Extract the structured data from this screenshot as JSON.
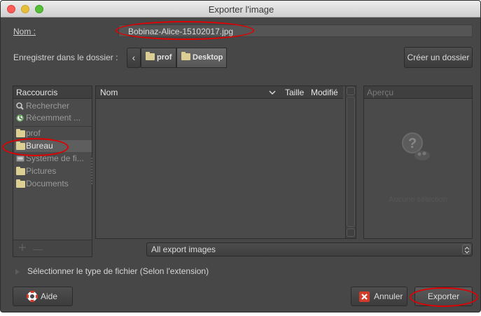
{
  "window": {
    "title": "Exporter l'image"
  },
  "name_row": {
    "label": "Nom :",
    "value": "Bobinaz-Alice-15102017.jpg"
  },
  "folder_row": {
    "label": "Enregistrer dans le dossier :",
    "back_glyph": "‹",
    "path": [
      "prof",
      "Desktop"
    ],
    "create_folder": "Créer un dossier"
  },
  "places": {
    "header": "Raccourcis",
    "items": [
      {
        "label": "Rechercher",
        "icon": "search-icon"
      },
      {
        "label": "Récemment ...",
        "icon": "recent-icon"
      },
      {
        "label": "prof",
        "icon": "folder-icon"
      },
      {
        "label": "Bureau",
        "icon": "folder-icon",
        "selected": true
      },
      {
        "label": "Système de fi...",
        "icon": "drive-icon"
      },
      {
        "label": "Pictures",
        "icon": "folder-icon"
      },
      {
        "label": "Documents",
        "icon": "folder-icon"
      }
    ],
    "add": "+",
    "remove": "—"
  },
  "files": {
    "col_name": "Nom",
    "col_size": "Taille",
    "col_modified": "Modifié"
  },
  "preview": {
    "header": "Aperçu",
    "no_selection": "Aucune sélection"
  },
  "filter": {
    "value": "All export images"
  },
  "filetype": {
    "label": "Sélectionner le type de fichier (Selon l'extension)"
  },
  "buttons": {
    "help": "Aide",
    "cancel": "Annuler",
    "export": "Exporter"
  },
  "colors": {
    "window_bg": "#474747",
    "selected_row": "#5e5e5e",
    "annotation": "#e00000"
  }
}
